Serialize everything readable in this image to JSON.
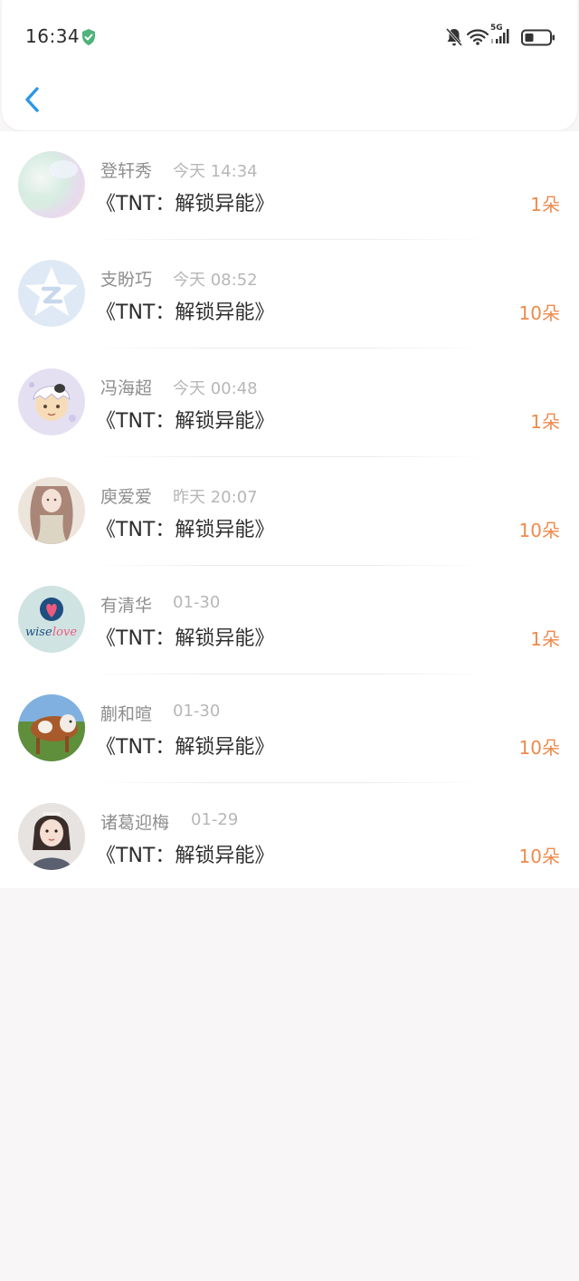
{
  "status_bar": {
    "time": "16:34",
    "network_label": "5G"
  },
  "colors": {
    "accent": "#2a97e8",
    "amount": "#ee8a4c",
    "shield": "#4fb37a"
  },
  "header": {
    "back_icon": "chevron-left-icon"
  },
  "records": [
    {
      "name": "登轩秀",
      "time": "今天 14:34",
      "title": "《TNT：解锁异能》",
      "amount": "1朵"
    },
    {
      "name": "支盼巧",
      "time": "今天 08:52",
      "title": "《TNT：解锁异能》",
      "amount": "10朵"
    },
    {
      "name": "冯海超",
      "time": "今天 00:48",
      "title": "《TNT：解锁异能》",
      "amount": "1朵"
    },
    {
      "name": "庾爱爱",
      "time": "昨天 20:07",
      "title": "《TNT：解锁异能》",
      "amount": "10朵"
    },
    {
      "name": "有清华",
      "time": "01-30",
      "title": "《TNT：解锁异能》",
      "amount": "1朵"
    },
    {
      "name": "蒯和暄",
      "time": "01-30",
      "title": "《TNT：解锁异能》",
      "amount": "10朵"
    },
    {
      "name": "诸葛迎梅",
      "time": "01-29",
      "title": "《TNT：解锁异能》",
      "amount": "10朵"
    }
  ],
  "avatar_texts": {
    "wiselove_wise": "wise",
    "wiselove_love": "love"
  }
}
